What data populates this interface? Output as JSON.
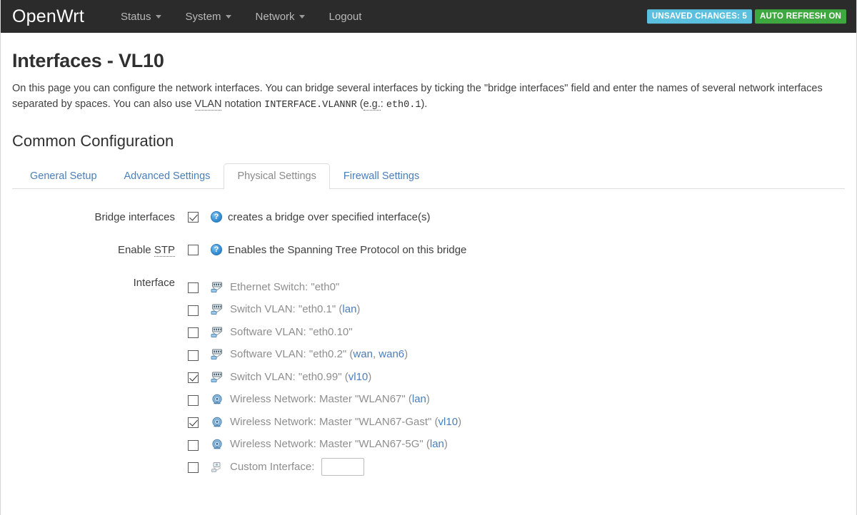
{
  "navbar": {
    "brand": "OpenWrt",
    "items": [
      {
        "label": "Status",
        "has_caret": true
      },
      {
        "label": "System",
        "has_caret": true
      },
      {
        "label": "Network",
        "has_caret": true
      },
      {
        "label": "Logout",
        "has_caret": false
      }
    ],
    "badges": {
      "unsaved_changes": "UNSAVED CHANGES: 5",
      "auto_refresh": "AUTO REFRESH ON",
      "unsaved_color": "#5bc0de",
      "refresh_color": "#3fa73f"
    }
  },
  "page": {
    "title": "Interfaces - VL10",
    "desc_part1": "On this page you can configure the network interfaces. You can bridge several interfaces by ticking the \"bridge interfaces\" field and enter the names of several network interfaces separated by spaces. You can also use ",
    "desc_abbr_vlan": "VLAN",
    "desc_part2": " notation ",
    "desc_code1": "INTERFACE.VLANNR",
    "desc_part3": " (",
    "desc_abbr_eg": "e.g.",
    "desc_part4": ": ",
    "desc_code2": "eth0.1",
    "desc_part5": ").",
    "section_title": "Common Configuration"
  },
  "tabs": [
    {
      "label": "General Setup",
      "active": false
    },
    {
      "label": "Advanced Settings",
      "active": false
    },
    {
      "label": "Physical Settings",
      "active": true
    },
    {
      "label": "Firewall Settings",
      "active": false
    }
  ],
  "form": {
    "bridge": {
      "label": "Bridge interfaces",
      "checked": true,
      "help_icon": "help-question-icon",
      "description": "creates a bridge over specified interface(s)"
    },
    "stp": {
      "label_prefix": "Enable ",
      "label_abbr": "STP",
      "checked": false,
      "help_icon": "help-question-icon",
      "description": "Enables the Spanning Tree Protocol on this bridge"
    },
    "interface": {
      "label": "Interface",
      "items": [
        {
          "icon": "ethernet-switch-icon",
          "text": "Ethernet Switch: \"eth0\"",
          "networks": [],
          "checked": false
        },
        {
          "icon": "ethernet-switch-icon",
          "text": "Switch VLAN: \"eth0.1\"",
          "networks": [
            "lan"
          ],
          "checked": false
        },
        {
          "icon": "ethernet-switch-icon",
          "text": "Software VLAN: \"eth0.10\"",
          "networks": [],
          "checked": false
        },
        {
          "icon": "ethernet-switch-icon",
          "text": "Software VLAN: \"eth0.2\"",
          "networks": [
            "wan",
            "wan6"
          ],
          "checked": false
        },
        {
          "icon": "ethernet-switch-icon",
          "text": "Switch VLAN: \"eth0.99\"",
          "networks": [
            "vl10"
          ],
          "checked": true
        },
        {
          "icon": "wireless-icon",
          "text": "Wireless Network: Master \"WLAN67\"",
          "networks": [
            "lan"
          ],
          "checked": false
        },
        {
          "icon": "wireless-icon",
          "text": "Wireless Network: Master \"WLAN67-Gast\"",
          "networks": [
            "vl10"
          ],
          "checked": true
        },
        {
          "icon": "wireless-icon",
          "text": "Wireless Network: Master \"WLAN67-5G\"",
          "networks": [
            "lan"
          ],
          "checked": false
        }
      ],
      "custom": {
        "icon": "custom-interface-icon",
        "label": "Custom Interface:",
        "checked": false,
        "value": "",
        "placeholder": ""
      }
    }
  }
}
